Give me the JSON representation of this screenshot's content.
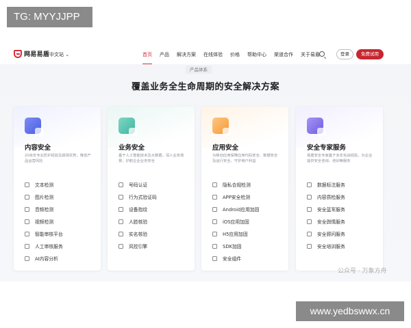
{
  "watermarks": {
    "top": "TG: MYYJJPP",
    "bottom": "www.yedbswwx.cn",
    "corner": "公众号 · 万象方舟"
  },
  "header": {
    "logo_text": "网易易盾",
    "site_selector": "中文站 ⌄",
    "nav": [
      "首页",
      "产品",
      "解决方案",
      "在线体验",
      "价格",
      "帮助中心",
      "渠道合作",
      "关于易盾"
    ],
    "active_index": 0,
    "login_label": "登录",
    "trial_label": "免费试用"
  },
  "colors": {
    "brand": "#c8262f",
    "active": "#d6303b"
  },
  "section": {
    "tag": "产品体系",
    "title": "覆盖业务全生命周期的安全解决方案"
  },
  "cards": [
    {
      "title": "内容安全",
      "desc": "20余年专业防护经验及舆情优势，降低产品运营风险",
      "items": [
        "文本检测",
        "图片检测",
        "音频检测",
        "视频检测",
        "智能审核平台",
        "人工审核服务",
        "AI内容分析"
      ]
    },
    {
      "title": "业务安全",
      "desc": "基于人工智能技术及大数据，深入业务场景，护航企业业务安全",
      "items": [
        "号码认证",
        "行为式验证码",
        "设备指纹",
        "人脸核验",
        "实名核验",
        "风控引擎"
      ]
    },
    {
      "title": "应用安全",
      "desc": "为移动应用保障应用代码安全、数据安全及运行安全，守护用户利益",
      "items": [
        "隐私合规检测",
        "APP安全检测",
        "Android应用加固",
        "iOS应用加固",
        "H5应用加固",
        "SDK加固",
        "安全组件"
      ]
    },
    {
      "title": "安全专家服务",
      "desc": "易盾安全专家基于多年实战经验，为企业提供安全咨询、培训等服务",
      "items": [
        "数据标注服务",
        "内容质检服务",
        "安全蓝军服务",
        "安全舆情服务",
        "安全顾问服务",
        "安全培训服务"
      ]
    }
  ]
}
